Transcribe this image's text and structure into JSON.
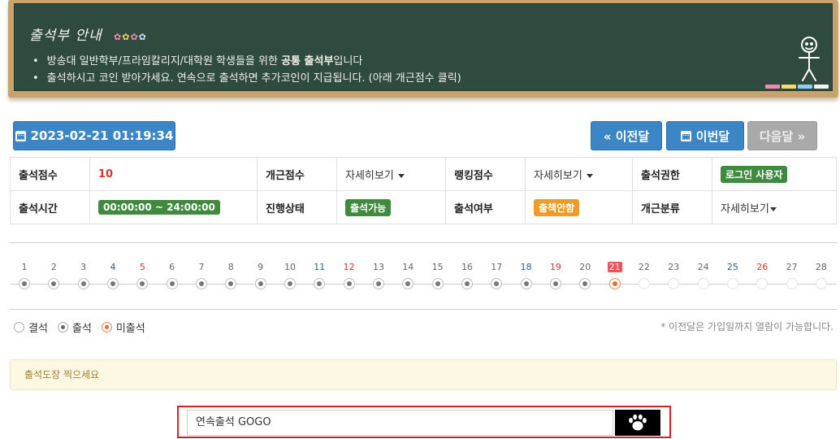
{
  "notice": {
    "title": "출석부 안내",
    "lines": [
      {
        "text": "방송대 일반학부/프라임칼리지/대학원 학생들을 위한 ",
        "bold": "공통 출석부",
        "tail": "입니다"
      },
      {
        "text": "출석하시고 코인 받아가세요. 연속으로 출석하면 추가코인이 지급됩니다. (아래 개근점수 클릭)"
      }
    ]
  },
  "toolbar": {
    "datetime": "2023-02-21 01:19:34",
    "prev_label": "« 이전달",
    "this_label": "이번달",
    "next_label": "다음달 »"
  },
  "info": {
    "score_label": "출석점수",
    "score_value": "10",
    "streak_label": "개근점수",
    "streak_value": "자세히보기",
    "rank_label": "랭킹점수",
    "rank_value": "자세히보기",
    "perm_label": "출석권한",
    "perm_value": "로그인 사용자",
    "time_label": "출석시간",
    "time_value": "00:00:00 ~ 24:00:00",
    "status_label": "진행상태",
    "status_value": "출석가능",
    "attend_label": "출석여부",
    "attend_value": "출책안함",
    "cat_label": "개근분류",
    "cat_value": "자세히보기"
  },
  "calendar": {
    "days": [
      "1",
      "2",
      "3",
      "4",
      "5",
      "6",
      "7",
      "8",
      "9",
      "10",
      "11",
      "12",
      "13",
      "14",
      "15",
      "16",
      "17",
      "18",
      "19",
      "20",
      "21",
      "22",
      "23",
      "24",
      "25",
      "26",
      "27",
      "28"
    ],
    "sat": [
      4,
      11,
      18,
      25
    ],
    "sun": [
      5,
      12,
      19,
      26
    ],
    "today": 21
  },
  "legend": {
    "absent": "결석",
    "present": "출석",
    "not_yet": "미출석",
    "note": "* 이전달은 가입일까지 열람이 가능합니다."
  },
  "stamp": {
    "message": "출석도장 찍으세요"
  },
  "gogo": {
    "value": "연속출석 GOGO"
  },
  "colors": {
    "board": "#2f4a3e",
    "button_blue": "#3d86c6",
    "tag_green": "#3f8a3f",
    "tag_orange": "#ee9c27",
    "highlight": "#d0232a"
  }
}
